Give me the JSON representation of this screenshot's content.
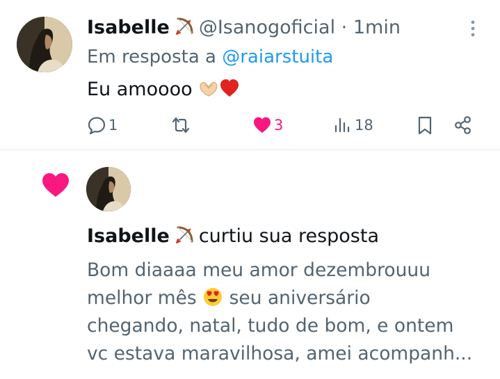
{
  "tweet": {
    "author_name": "Isabelle",
    "author_badge_icon": "bow-and-arrow-emoji",
    "handle": "@Isanogoficial",
    "separator": "·",
    "time": "1min",
    "reply_prefix": "Em resposta a",
    "reply_mention": "@raiarstuita",
    "text": "Eu amoooo",
    "text_emojis": [
      "heart-hands-emoji",
      "red-heart-emoji"
    ],
    "actions": {
      "reply_count": "1",
      "retweet_count": "",
      "like_count": "3",
      "views_count": "18"
    }
  },
  "notification": {
    "type_icon": "pink-heart-icon",
    "actor_name": "Isabelle",
    "actor_badge_icon": "bow-and-arrow-emoji",
    "action_text": "curtiu sua resposta",
    "preview_lines": [
      "Bom diaaaa meu amor dezembrouuu",
      "melhor mês",
      "seu aniversário",
      "chegando, natal, tudo de bom, e ontem",
      "vc estava maravilhosa, amei acompanh..."
    ],
    "preview_emoji": "heart-eyes-emoji"
  },
  "colors": {
    "text_primary": "#0f1419",
    "text_secondary": "#536471",
    "link": "#1d9bf0",
    "like_pink": "#f91880",
    "divider": "#e3e7ea"
  }
}
